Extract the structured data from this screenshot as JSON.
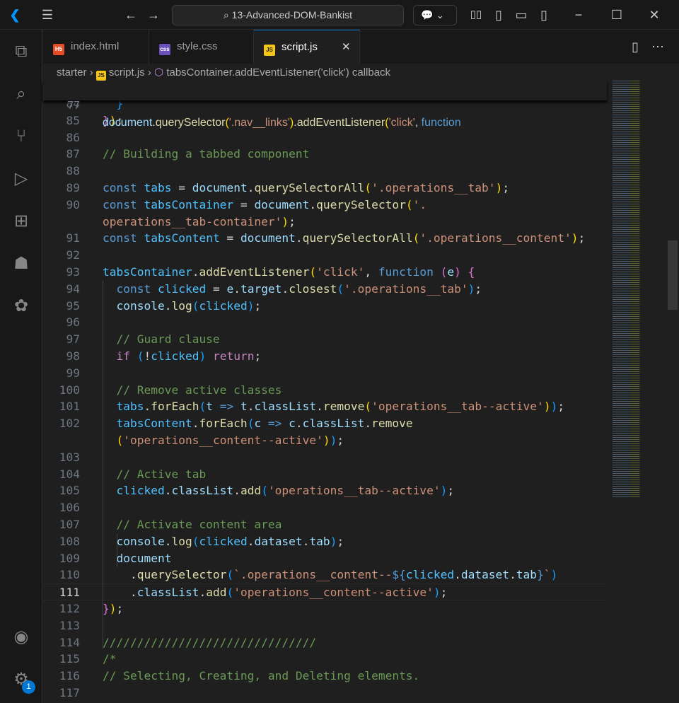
{
  "titlebar": {
    "search": "13-Advanced-DOM-Bankist",
    "icons": [
      "vscode-logo",
      "menu-icon",
      "back-arrow",
      "forward-arrow",
      "copilot-icon",
      "layout-icons",
      "minimize",
      "maximize",
      "close"
    ]
  },
  "tabs": [
    {
      "label": "index.html",
      "icon": "H5",
      "color": "#e44d26"
    },
    {
      "label": "style.css",
      "icon": "css",
      "color": "#6b4fbb"
    },
    {
      "label": "script.js",
      "icon": "JS",
      "color": "#f5c518",
      "active": true,
      "close": "✕"
    }
  ],
  "breadcrumb": {
    "folder": "starter",
    "file": "script.js",
    "symbol": "tabsContainer.addEventListener('click') callback",
    "sep": "›"
  },
  "activity": {
    "badge": "1"
  },
  "sticky": {
    "num": "77",
    "tokens": [
      [
        "document",
        "v"
      ],
      [
        ".",
        "p"
      ],
      [
        "querySelector",
        "f"
      ],
      [
        "(",
        "b1"
      ],
      [
        "'.nav__links'",
        "s"
      ],
      [
        ")",
        "b1"
      ],
      [
        ".",
        "p"
      ],
      [
        "addEventListener",
        "f"
      ],
      [
        "(",
        "b1"
      ],
      [
        "'click'",
        "s"
      ],
      [
        ", ",
        "p"
      ],
      [
        "function",
        "k"
      ]
    ]
  },
  "lines": [
    {
      "num": "84",
      "tokens": [
        [
          "  ",
          "p"
        ],
        [
          "}",
          "b3"
        ]
      ]
    },
    {
      "num": "85",
      "tokens": [
        [
          "}",
          "b2"
        ],
        [
          ")",
          "b1"
        ],
        [
          ";",
          "p"
        ]
      ]
    },
    {
      "num": "86",
      "tokens": []
    },
    {
      "num": "87",
      "tokens": [
        [
          "// Building a tabbed component",
          "c"
        ]
      ]
    },
    {
      "num": "88",
      "tokens": []
    },
    {
      "num": "89",
      "tokens": [
        [
          "const ",
          "k"
        ],
        [
          "tabs",
          "cst"
        ],
        [
          " = ",
          "p"
        ],
        [
          "document",
          "v"
        ],
        [
          ".",
          "p"
        ],
        [
          "querySelectorAll",
          "f"
        ],
        [
          "(",
          "b1"
        ],
        [
          "'.operations__tab'",
          "s"
        ],
        [
          ")",
          "b1"
        ],
        [
          ";",
          "p"
        ]
      ]
    },
    {
      "num": "90",
      "tokens": [
        [
          "const ",
          "k"
        ],
        [
          "tabsContainer",
          "cst"
        ],
        [
          " = ",
          "p"
        ],
        [
          "document",
          "v"
        ],
        [
          ".",
          "p"
        ],
        [
          "querySelector",
          "f"
        ],
        [
          "(",
          "b1"
        ],
        [
          "'.",
          "s"
        ]
      ]
    },
    {
      "num": "",
      "tokens": [
        [
          "operations__tab-container'",
          "s"
        ],
        [
          ")",
          "b1"
        ],
        [
          ";",
          "p"
        ]
      ]
    },
    {
      "num": "91",
      "tokens": [
        [
          "const ",
          "k"
        ],
        [
          "tabsContent",
          "cst"
        ],
        [
          " = ",
          "p"
        ],
        [
          "document",
          "v"
        ],
        [
          ".",
          "p"
        ],
        [
          "querySelectorAll",
          "f"
        ],
        [
          "(",
          "b1"
        ],
        [
          "'.operations__content'",
          "s"
        ],
        [
          ")",
          "b1"
        ],
        [
          ";",
          "p"
        ]
      ]
    },
    {
      "num": "92",
      "tokens": []
    },
    {
      "num": "93",
      "tokens": [
        [
          "tabsContainer",
          "cst"
        ],
        [
          ".",
          "p"
        ],
        [
          "addEventListener",
          "f"
        ],
        [
          "(",
          "b1"
        ],
        [
          "'click'",
          "s"
        ],
        [
          ", ",
          "p"
        ],
        [
          "function ",
          "k"
        ],
        [
          "(",
          "b2"
        ],
        [
          "e",
          "v"
        ],
        [
          ")",
          "b2"
        ],
        [
          " {",
          "b2"
        ]
      ]
    },
    {
      "num": "94",
      "tokens": [
        [
          "  const ",
          "k"
        ],
        [
          "clicked",
          "cst"
        ],
        [
          " = ",
          "p"
        ],
        [
          "e",
          "v"
        ],
        [
          ".",
          "p"
        ],
        [
          "target",
          "v"
        ],
        [
          ".",
          "p"
        ],
        [
          "closest",
          "f"
        ],
        [
          "(",
          "b3"
        ],
        [
          "'.operations__tab'",
          "s"
        ],
        [
          ")",
          "b3"
        ],
        [
          ";",
          "p"
        ]
      ]
    },
    {
      "num": "95",
      "tokens": [
        [
          "  console",
          "v"
        ],
        [
          ".",
          "p"
        ],
        [
          "log",
          "f"
        ],
        [
          "(",
          "b3"
        ],
        [
          "clicked",
          "cst"
        ],
        [
          ")",
          "b3"
        ],
        [
          ";",
          "p"
        ]
      ]
    },
    {
      "num": "96",
      "tokens": []
    },
    {
      "num": "97",
      "tokens": [
        [
          "  // Guard clause",
          "c"
        ]
      ]
    },
    {
      "num": "98",
      "tokens": [
        [
          "  if ",
          "ctl"
        ],
        [
          "(",
          "b3"
        ],
        [
          "!",
          "p"
        ],
        [
          "clicked",
          "cst"
        ],
        [
          ")",
          "b3"
        ],
        [
          " return",
          "ctl"
        ],
        [
          ";",
          "p"
        ]
      ]
    },
    {
      "num": "99",
      "tokens": []
    },
    {
      "num": "100",
      "tokens": [
        [
          "  // Remove active classes",
          "c"
        ]
      ]
    },
    {
      "num": "101",
      "tokens": [
        [
          "  tabs",
          "cst"
        ],
        [
          ".",
          "p"
        ],
        [
          "forEach",
          "f"
        ],
        [
          "(",
          "b3"
        ],
        [
          "t",
          "v"
        ],
        [
          " => ",
          "k"
        ],
        [
          "t",
          "v"
        ],
        [
          ".",
          "p"
        ],
        [
          "classList",
          "v"
        ],
        [
          ".",
          "p"
        ],
        [
          "remove",
          "f"
        ],
        [
          "(",
          "b1"
        ],
        [
          "'operations__tab--active'",
          "s"
        ],
        [
          ")",
          "b1"
        ],
        [
          ")",
          "b3"
        ],
        [
          ";",
          "p"
        ]
      ]
    },
    {
      "num": "102",
      "tokens": [
        [
          "  tabsContent",
          "cst"
        ],
        [
          ".",
          "p"
        ],
        [
          "forEach",
          "f"
        ],
        [
          "(",
          "b3"
        ],
        [
          "c",
          "v"
        ],
        [
          " => ",
          "k"
        ],
        [
          "c",
          "v"
        ],
        [
          ".",
          "p"
        ],
        [
          "classList",
          "v"
        ],
        [
          ".",
          "p"
        ],
        [
          "remove",
          "f"
        ]
      ]
    },
    {
      "num": "",
      "tokens": [
        [
          "  ",
          "p"
        ],
        [
          "(",
          "b1"
        ],
        [
          "'operations__content--active'",
          "s"
        ],
        [
          ")",
          "b1"
        ],
        [
          ")",
          "b3"
        ],
        [
          ";",
          "p"
        ]
      ]
    },
    {
      "num": "103",
      "tokens": []
    },
    {
      "num": "104",
      "tokens": [
        [
          "  // Active tab",
          "c"
        ]
      ]
    },
    {
      "num": "105",
      "tokens": [
        [
          "  clicked",
          "cst"
        ],
        [
          ".",
          "p"
        ],
        [
          "classList",
          "v"
        ],
        [
          ".",
          "p"
        ],
        [
          "add",
          "f"
        ],
        [
          "(",
          "b3"
        ],
        [
          "'operations__tab--active'",
          "s"
        ],
        [
          ")",
          "b3"
        ],
        [
          ";",
          "p"
        ]
      ]
    },
    {
      "num": "106",
      "tokens": []
    },
    {
      "num": "107",
      "tokens": [
        [
          "  // Activate content area",
          "c"
        ]
      ]
    },
    {
      "num": "108",
      "tokens": [
        [
          "  console",
          "v"
        ],
        [
          ".",
          "p"
        ],
        [
          "log",
          "f"
        ],
        [
          "(",
          "b3"
        ],
        [
          "clicked",
          "cst"
        ],
        [
          ".",
          "p"
        ],
        [
          "dataset",
          "v"
        ],
        [
          ".",
          "p"
        ],
        [
          "tab",
          "v"
        ],
        [
          ")",
          "b3"
        ],
        [
          ";",
          "p"
        ]
      ]
    },
    {
      "num": "109",
      "tokens": [
        [
          "  document",
          "v"
        ]
      ]
    },
    {
      "num": "110",
      "tokens": [
        [
          "    .",
          "p"
        ],
        [
          "querySelector",
          "f"
        ],
        [
          "(",
          "b3"
        ],
        [
          "`.operations__content--",
          "s"
        ],
        [
          "${",
          "k"
        ],
        [
          "clicked",
          "cst"
        ],
        [
          ".",
          "p"
        ],
        [
          "dataset",
          "v"
        ],
        [
          ".",
          "p"
        ],
        [
          "tab",
          "v"
        ],
        [
          "}",
          "k"
        ],
        [
          "`",
          "s"
        ],
        [
          ")",
          "b3"
        ]
      ]
    },
    {
      "num": "111",
      "current": true,
      "tokens": [
        [
          "    .",
          "p"
        ],
        [
          "classList",
          "v"
        ],
        [
          ".",
          "p"
        ],
        [
          "add",
          "f"
        ],
        [
          "(",
          "b3"
        ],
        [
          "'operations__content--active'",
          "s"
        ],
        [
          ")",
          "b3"
        ],
        [
          ";",
          "p"
        ]
      ]
    },
    {
      "num": "112",
      "tokens": [
        [
          "}",
          "b2"
        ],
        [
          ")",
          "b1"
        ],
        [
          ";",
          "p"
        ]
      ]
    },
    {
      "num": "113",
      "tokens": []
    },
    {
      "num": "114",
      "tokens": [
        [
          "///////////////////////////////",
          "c"
        ]
      ]
    },
    {
      "num": "115",
      "tokens": [
        [
          "/*",
          "c"
        ]
      ]
    },
    {
      "num": "116",
      "tokens": [
        [
          "// Selecting, Creating, and Deleting elements.",
          "c"
        ]
      ]
    },
    {
      "num": "117",
      "tokens": []
    }
  ]
}
